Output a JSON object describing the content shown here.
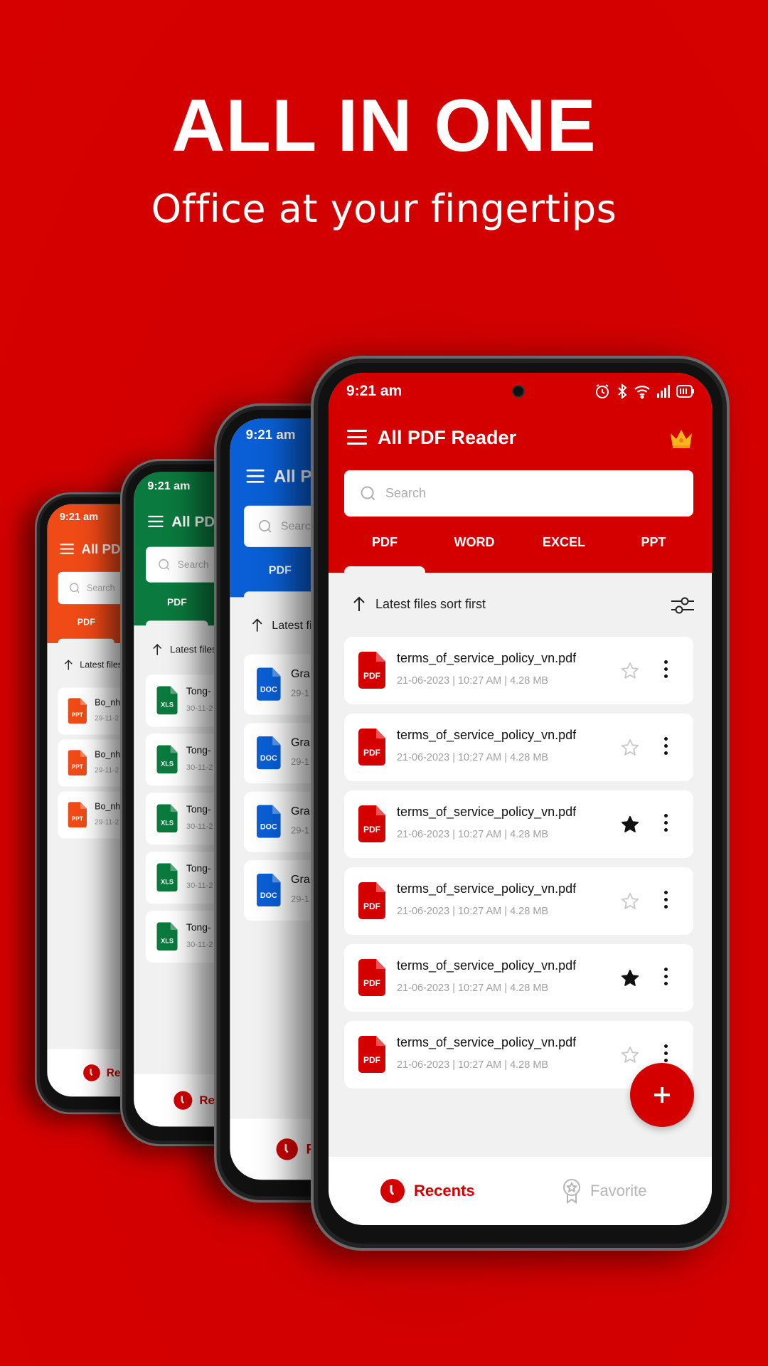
{
  "hero": {
    "headline": "ALL IN ONE",
    "subheadline": "Office at your fingertips"
  },
  "app": {
    "status_time": "9:21 am",
    "title": "All PDF Reader",
    "search_placeholder": "Search",
    "tabs": [
      "PDF",
      "WORD",
      "EXCEL",
      "PPT"
    ],
    "active_tab": "PDF",
    "sort_label": "Latest files sort first",
    "nav": {
      "recents": "Recents",
      "favorite": "Favorite"
    }
  },
  "colors": {
    "pdf_red": "#D40000",
    "excel_green": "#0B7A3E",
    "word_blue": "#0A5FD6",
    "ppt_orange": "#F04A16",
    "inactive_gray": "#B5B5B5"
  },
  "phones": [
    {
      "theme": "ppt_orange",
      "file_type": "PPT",
      "files": [
        {
          "name": "Bo_nh",
          "meta": "29-11-2"
        },
        {
          "name": "Bo_nh",
          "meta": "29-11-2"
        },
        {
          "name": "Bo_nh",
          "meta": "29-11-2"
        }
      ]
    },
    {
      "theme": "excel_green",
      "file_type": "XLS",
      "files": [
        {
          "name": "Tong-",
          "meta": "30-11-2"
        },
        {
          "name": "Tong-",
          "meta": "30-11-2"
        },
        {
          "name": "Tong-",
          "meta": "30-11-2"
        },
        {
          "name": "Tong-",
          "meta": "30-11-2"
        },
        {
          "name": "Tong-",
          "meta": "30-11-2"
        }
      ]
    },
    {
      "theme": "word_blue",
      "file_type": "DOC",
      "files": [
        {
          "name": "Gra",
          "meta": "29-1"
        },
        {
          "name": "Gra",
          "meta": "29-1"
        },
        {
          "name": "Gra",
          "meta": "29-1"
        },
        {
          "name": "Gra",
          "meta": "29-1"
        }
      ]
    },
    {
      "theme": "pdf_red",
      "file_type": "PDF",
      "main": true,
      "files": [
        {
          "name": "terms_of_service_policy_vn.pdf",
          "meta": "21-06-2023  |  10:27 AM  |  4.28 MB",
          "favorite": false
        },
        {
          "name": "terms_of_service_policy_vn.pdf",
          "meta": "21-06-2023  |  10:27 AM  |  4.28 MB",
          "favorite": false
        },
        {
          "name": "terms_of_service_policy_vn.pdf",
          "meta": "21-06-2023  |  10:27 AM  |  4.28 MB",
          "favorite": true
        },
        {
          "name": "terms_of_service_policy_vn.pdf",
          "meta": "21-06-2023  |  10:27 AM  |  4.28 MB",
          "favorite": false
        },
        {
          "name": "terms_of_service_policy_vn.pdf",
          "meta": "21-06-2023  |  10:27 AM  |  4.28 MB",
          "favorite": true
        },
        {
          "name": "terms_of_service_policy_vn.pdf",
          "meta": "21-06-2023  |  10:27 AM  |  4.28 MB",
          "favorite": false
        }
      ]
    }
  ]
}
